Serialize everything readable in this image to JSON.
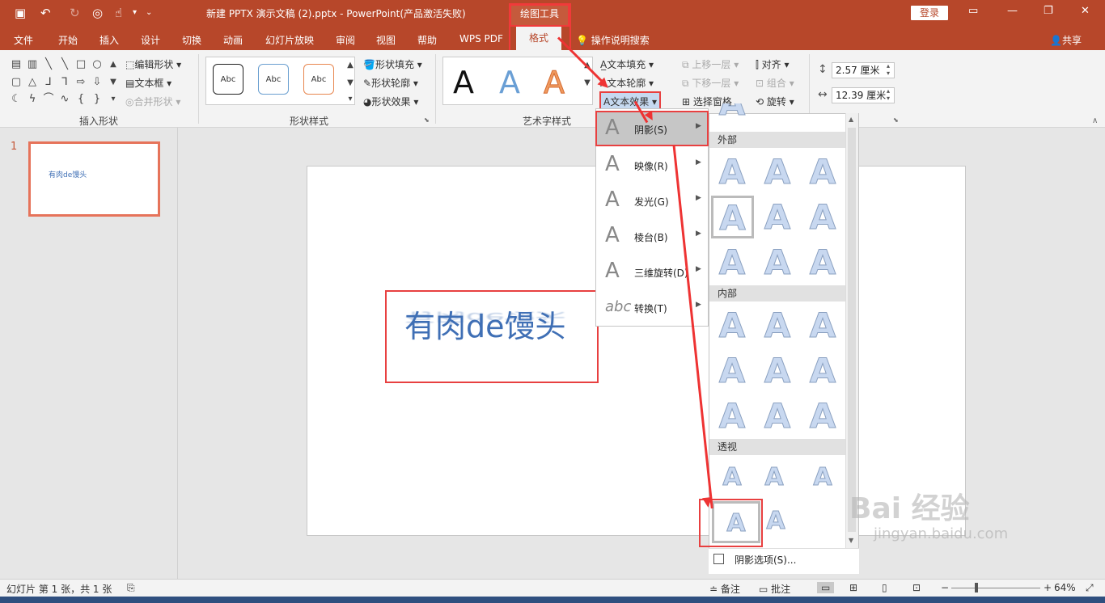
{
  "titlebar": {
    "doc_title": "新建 PPTX 演示文稿 (2).pptx  -  PowerPoint(产品激活失败)",
    "context_tab": "绘图工具",
    "login": "登录"
  },
  "menubar": {
    "items": [
      "文件",
      "开始",
      "插入",
      "设计",
      "切换",
      "动画",
      "幻灯片放映",
      "审阅",
      "视图",
      "帮助",
      "WPS PDF"
    ],
    "active_tab": "格式",
    "search": "操作说明搜索",
    "share": "共享"
  },
  "ribbon": {
    "insert_shapes": {
      "edit_shape": "编辑形状",
      "text_box": "文本框",
      "merge_shapes": "合并形状",
      "label": "插入形状"
    },
    "shape_styles": {
      "style_sample": "Abc",
      "fill": "形状填充",
      "outline": "形状轮廓",
      "effects": "形状效果",
      "label": "形状样式"
    },
    "wordart": {
      "glyph": "A",
      "text_fill": "文本填充",
      "text_outline": "文本轮廓",
      "text_effects": "文本效果",
      "label": "艺术字样式"
    },
    "arrange": {
      "bring_forward": "上移一层",
      "send_backward": "下移一层",
      "selection_pane": "选择窗格",
      "align": "对齐",
      "group": "组合",
      "rotate": "旋转"
    },
    "size": {
      "height": "2.57 厘米",
      "width": "12.39 厘米"
    }
  },
  "slides_pane": {
    "number": "1",
    "thumb_text": "有肉de馒头"
  },
  "slide": {
    "title": "有肉de馒头"
  },
  "effects_menu": {
    "items": [
      {
        "label": "阴影(S)",
        "icon": "A"
      },
      {
        "label": "映像(R)",
        "icon": "A"
      },
      {
        "label": "发光(G)",
        "icon": "A"
      },
      {
        "label": "棱台(B)",
        "icon": "A"
      },
      {
        "label": "三维旋转(D)",
        "icon": "A"
      },
      {
        "label": "转换(T)",
        "icon": "abc"
      }
    ]
  },
  "shadow_gallery": {
    "sections": [
      "外部",
      "内部",
      "透视"
    ],
    "glyph": "A",
    "options": "阴影选项(S)..."
  },
  "statusbar": {
    "slide_info": "幻灯片 第 1 张，共 1 张",
    "notes": "备注",
    "comments": "批注",
    "zoom": "64%"
  },
  "watermark": {
    "text": "Bai  经验",
    "sub": "jingyan.baidu.com"
  }
}
